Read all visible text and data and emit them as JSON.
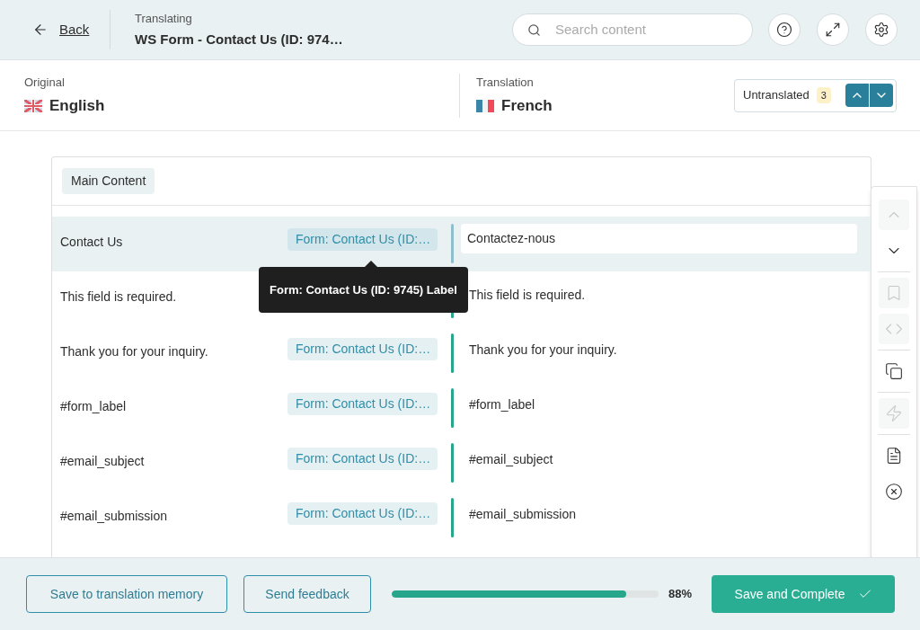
{
  "header": {
    "back": "Back",
    "subtitle": "Translating",
    "title": "WS Form - Contact Us (ID: 974…",
    "search": {
      "placeholder": "Search content"
    }
  },
  "languages": {
    "original": {
      "label": "Original",
      "name": "English"
    },
    "translation": {
      "label": "Translation",
      "name": "French"
    },
    "filter": {
      "label": "Untranslated",
      "count": "3"
    }
  },
  "section": "Main Content",
  "segments": [
    {
      "source": "Contact Us",
      "tag": "Form: Contact Us (ID:…",
      "target": "Contactez-nous",
      "selected": true
    },
    {
      "source": "This field is required.",
      "target": "This field is required.",
      "selected": false
    },
    {
      "source": "Thank you for your inquiry.",
      "tag": "Form: Contact Us (ID:…",
      "target": "Thank you for your inquiry.",
      "selected": false
    },
    {
      "source": "#form_label",
      "tag": "Form: Contact Us (ID:…",
      "target": "#form_label",
      "selected": false
    },
    {
      "source": "#email_subject",
      "tag": "Form: Contact Us (ID:…",
      "target": "#email_subject",
      "selected": false
    },
    {
      "source": "#email_submission",
      "tag": "Form: Contact Us (ID:…",
      "target": "#email_submission",
      "selected": false
    }
  ],
  "tooltip": "Form: Contact Us (ID: 9745) Label",
  "toolbar": [
    [
      {
        "kind": "up",
        "disabled": true
      },
      {
        "kind": "down",
        "disabled": false
      }
    ],
    [
      {
        "kind": "bookmark",
        "disabled": true
      },
      {
        "kind": "code",
        "disabled": true
      }
    ],
    [
      {
        "kind": "copy",
        "disabled": false
      }
    ],
    [
      {
        "kind": "bolt",
        "disabled": true
      }
    ],
    [
      {
        "kind": "note",
        "disabled": false
      },
      {
        "kind": "close",
        "disabled": false
      }
    ]
  ],
  "footer": {
    "save_memory": "Save to translation memory",
    "feedback": "Send feedback",
    "progress": {
      "level": 0.88,
      "reading": "88%"
    },
    "complete": "Save and Complete"
  }
}
